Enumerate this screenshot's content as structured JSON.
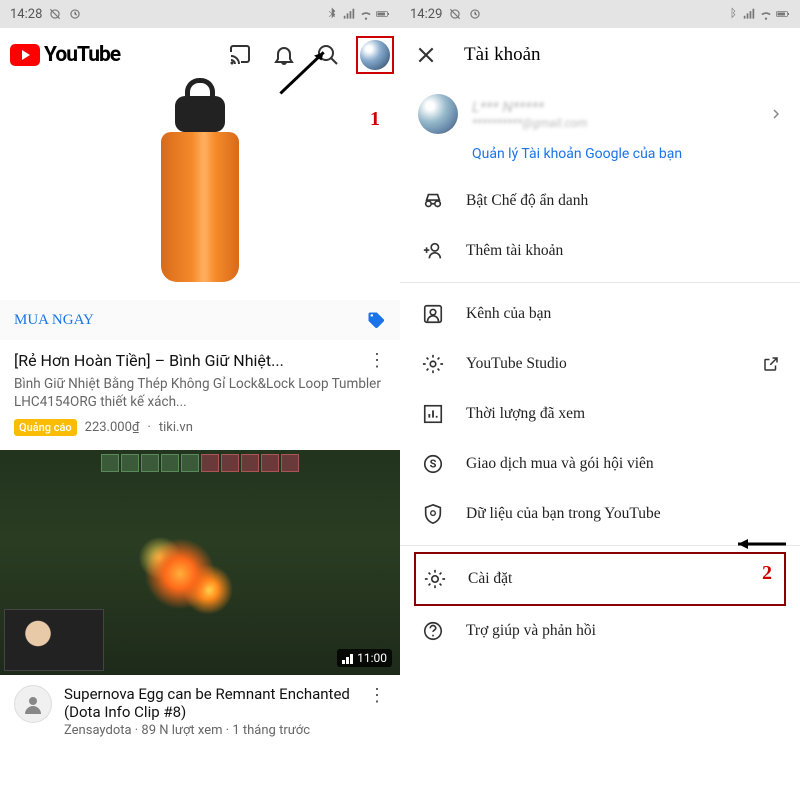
{
  "left": {
    "status": {
      "time": "14:28"
    },
    "logo_text": "YouTube",
    "ad": {
      "buy_now": "MUA NGAY",
      "title": "[Rẻ Hơn Hoàn Tiền] – Bình Giữ Nhiệt...",
      "desc": "Bình Giữ Nhiệt Bằng Thép Không Gỉ Lock&Lock Loop Tumbler LHC4154ORG thiết kế xách...",
      "badge": "Quảng cáo",
      "price": "223.000₫",
      "source": "tiki.vn"
    },
    "video": {
      "duration": "11:00",
      "title": "Supernova Egg can be Remnant Enchanted (Dota Info Clip #8)",
      "channel": "Zensaydota",
      "views": "89 N lượt xem",
      "age": "1 tháng trước"
    },
    "annotation_num": "1"
  },
  "right": {
    "status": {
      "time": "14:29"
    },
    "title": "Tài khoản",
    "profile": {
      "name": "L*** N*****",
      "email": "**********@gmail.com",
      "manage": "Quản lý Tài khoản Google của bạn"
    },
    "menu": {
      "incognito": "Bật Chế độ ẩn danh",
      "add_account": "Thêm tài khoản",
      "your_channel": "Kênh của bạn",
      "studio": "YouTube Studio",
      "time_watched": "Thời lượng đã xem",
      "purchases": "Giao dịch mua và gói hội viên",
      "your_data": "Dữ liệu của bạn trong YouTube",
      "settings": "Cài đặt",
      "help": "Trợ giúp và phản hồi"
    },
    "annotation_num": "2"
  }
}
